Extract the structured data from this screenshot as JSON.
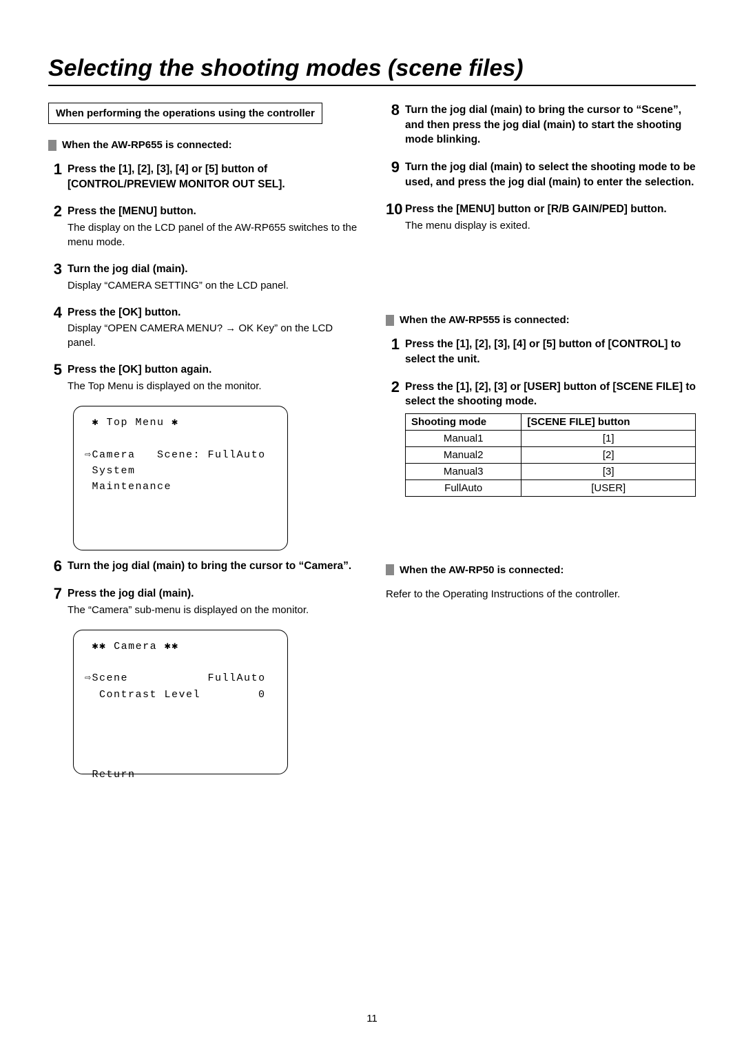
{
  "title": "Selecting the shooting modes (scene files)",
  "boxed_header": "When performing the operations using the controller",
  "section_655": "When the AW-RP655 is connected:",
  "section_555": "When the AW-RP555 is connected:",
  "section_50": "When the AW-RP50 is connected:",
  "steps655": {
    "s1": {
      "title": "Press the [1], [2], [3], [4] or [5] button of [CONTROL/PREVIEW MONITOR OUT SEL]."
    },
    "s2": {
      "title": "Press the [MENU] button.",
      "desc": "The display on the LCD panel of the AW-RP655 switches to the menu mode."
    },
    "s3": {
      "title": "Turn the jog dial (main).",
      "desc": "Display “CAMERA SETTING” on the LCD panel."
    },
    "s4": {
      "title": "Press the [OK] button.",
      "desc": "Display “OPEN CAMERA MENU? → OK Key” on the LCD panel."
    },
    "s5": {
      "title": "Press the [OK] button again.",
      "desc": "The Top Menu is displayed on the monitor."
    },
    "s6": {
      "title": "Turn the jog dial (main) to bring the cursor to “Camera”."
    },
    "s7": {
      "title": "Press the jog dial (main).",
      "desc": "The “Camera” sub-menu is displayed on the monitor."
    },
    "s8": {
      "title": "Turn the jog dial (main) to bring the cursor to “Scene”, and then press the jog dial (main) to start the shooting mode blinking."
    },
    "s9": {
      "title": "Turn the jog dial (main) to select the shooting mode to be used, and press the jog dial (main) to enter the selection."
    },
    "s10": {
      "title": "Press the [MENU] button or [R/B GAIN/PED] button.",
      "desc": "The menu display is exited."
    }
  },
  "steps555": {
    "s1": {
      "title": "Press the [1], [2], [3], [4] or [5] button of [CONTROL] to select the unit."
    },
    "s2": {
      "title": "Press the [1], [2], [3] or [USER] button of [SCENE FILE] to select the shooting mode."
    }
  },
  "rp50_text": "Refer to the Operating Instructions of the controller.",
  "menu1": " ✱ Top Menu ✱\n\n⇨Camera   Scene: FullAuto\n System\n Maintenance",
  "menu2": " ✱✱ Camera ✱✱\n\n⇨Scene           FullAuto\n  Contrast Level        0\n\n\n\n\n Return",
  "table": {
    "h1": "Shooting mode",
    "h2": "[SCENE FILE] button",
    "rows": [
      {
        "mode": "Manual1",
        "btn": "[1]"
      },
      {
        "mode": "Manual2",
        "btn": "[2]"
      },
      {
        "mode": "Manual3",
        "btn": "[3]"
      },
      {
        "mode": "FullAuto",
        "btn": "[USER]"
      }
    ]
  },
  "page_num": "11"
}
